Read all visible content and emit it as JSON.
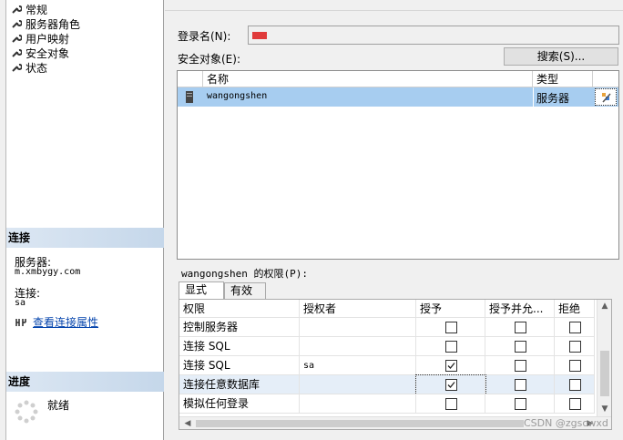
{
  "pages": [
    "常规",
    "服务器角色",
    "用户映射",
    "安全对象",
    "状态"
  ],
  "connection": {
    "header": "连接",
    "server_label": "服务器:",
    "server_value": "m.xmbygy.com",
    "conn_label": "连接:",
    "conn_value": "sa",
    "link": "查看连接属性"
  },
  "progress": {
    "header": "进度",
    "status": "就绪"
  },
  "form": {
    "login_label": "登录名(N):",
    "securables_label": "安全对象(E):",
    "search_button": "搜索(S)..."
  },
  "securables_table": {
    "columns": [
      "名称",
      "类型"
    ],
    "rows": [
      {
        "name": "wangongshen",
        "type": "服务器"
      }
    ]
  },
  "permissions": {
    "label": "wangongshen 的权限(P):",
    "tabs": [
      "显式",
      "有效"
    ],
    "columns": [
      "权限",
      "授权者",
      "授予",
      "授予并允...",
      "拒绝"
    ],
    "rows": [
      {
        "perm": "控制服务器",
        "grantor": "",
        "grant": false,
        "with_grant": false,
        "deny": false
      },
      {
        "perm": "连接 SQL",
        "grantor": "",
        "grant": false,
        "with_grant": false,
        "deny": false
      },
      {
        "perm": "连接 SQL",
        "grantor": "sa",
        "grant": true,
        "with_grant": false,
        "deny": false
      },
      {
        "perm": "连接任意数据库",
        "grantor": "",
        "grant": true,
        "with_grant": false,
        "deny": false
      },
      {
        "perm": "模拟任何登录",
        "grantor": "",
        "grant": false,
        "with_grant": false,
        "deny": false
      }
    ]
  },
  "watermark": "CSDN @zgscwxd"
}
